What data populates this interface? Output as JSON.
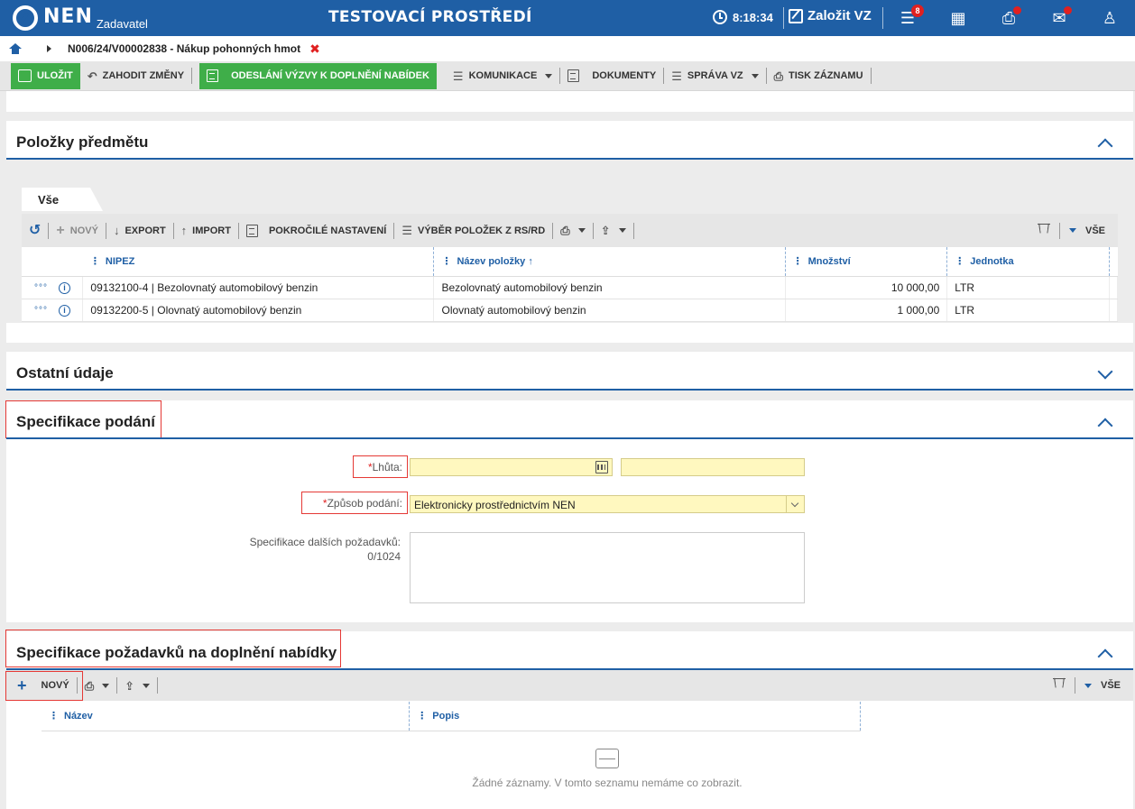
{
  "header": {
    "logo_text": "NEN",
    "logo_sub": "Zadavatel",
    "environment": "TESTOVACÍ PROSTŘEDÍ",
    "time": "8:18:34",
    "create_label": "Založit VZ",
    "menu_badge": "8",
    "icons": [
      "clock-icon",
      "pen-icon",
      "menu-icon",
      "calculator-icon",
      "inbox-icon",
      "mail-icon",
      "user-icon"
    ],
    "accent": "#1f5fa5"
  },
  "breadcrumb": {
    "text": "N006/24/V00002838 - Nákup pohonných hmot",
    "close": "✖"
  },
  "toolbar": {
    "save": "ULOŽIT",
    "discard": "ZAHODIT ZMĚNY",
    "send": "ODESLÁNÍ VÝZVY K DOPLNĚNÍ NABÍDEK",
    "communication": "KOMUNIKACE",
    "documents": "DOKUMENTY",
    "manage": "SPRÁVA VZ",
    "print": "TISK ZÁZNAMU",
    "green": "#3fae49"
  },
  "items_section": {
    "title": "Položky předmětu",
    "tab": "Vše",
    "toolbar": {
      "new": "NOVÝ",
      "export": "EXPORT",
      "import": "IMPORT",
      "advanced": "POKROČILÉ NASTAVENÍ",
      "select": "VÝBĚR POLOŽEK Z RS/RD",
      "all": "VŠE"
    },
    "columns": [
      "NIPEZ",
      "Název položky",
      "Množství",
      "Jednotka"
    ],
    "sort_indicator": "↑",
    "rows": [
      {
        "nipez": "09132100-4 | Bezolovnatý automobilový benzin",
        "name": "Bezolovnatý automobilový benzin",
        "qty": "10 000,00",
        "unit": "LTR"
      },
      {
        "nipez": "09132200-5 | Olovnatý automobilový benzin",
        "name": "Olovnatý automobilový benzin",
        "qty": "1 000,00",
        "unit": "LTR"
      }
    ]
  },
  "other_section": {
    "title": "Ostatní údaje"
  },
  "submission_section": {
    "title": "Specifikace podání",
    "deadline_label": "Lhůta:",
    "deadline_date": "",
    "deadline_time": "",
    "method_label": "Způsob podání:",
    "method_value": "Elektronicky prostřednictvím NEN",
    "additional_label": "Specifikace dalších požadavků:",
    "additional_counter": "0/1024",
    "required_mark": "*"
  },
  "requirements_section": {
    "title": "Specifikace požadavků na doplnění nabídky",
    "new": "NOVÝ",
    "all": "VŠE",
    "columns": [
      "Název",
      "Popis"
    ],
    "empty_text": "Žádné záznamy. V tomto seznamu nemáme co zobrazit."
  }
}
